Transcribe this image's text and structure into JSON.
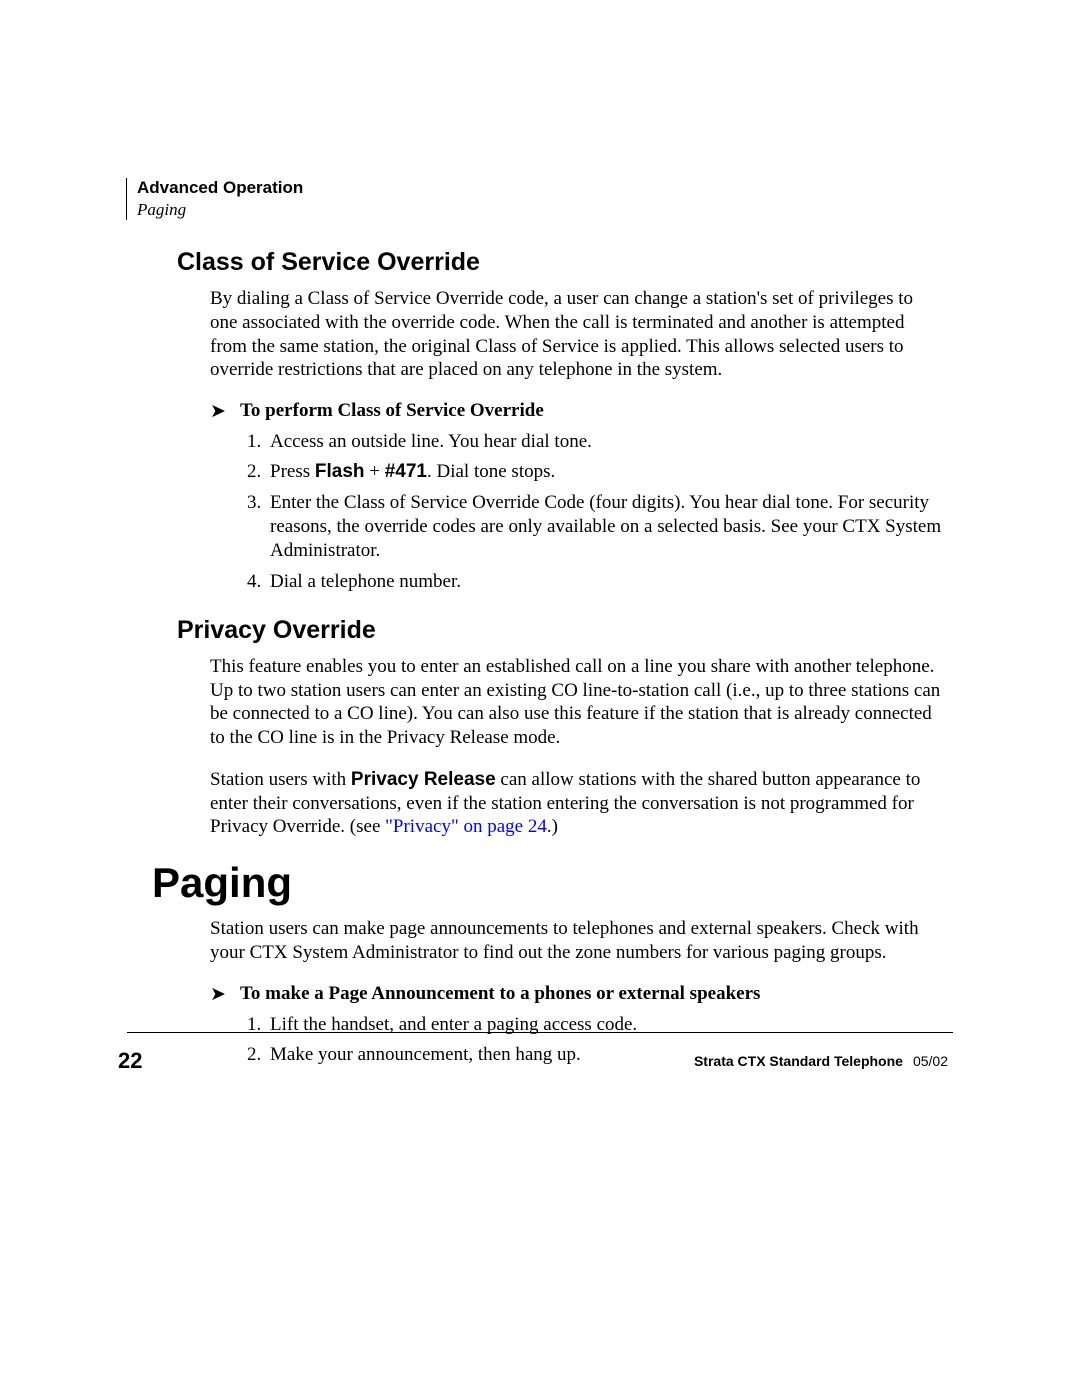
{
  "header": {
    "chapter": "Advanced Operation",
    "section": "Paging"
  },
  "sections": {
    "cos": {
      "heading": "Class of Service Override",
      "para": "By dialing a Class of Service Override code, a user can change a station's set of privileges to one associated with the override code. When the call is terminated and another is attempted from the same station, the original Class of Service is applied. This allows selected users to override restrictions that are placed on any telephone in the system.",
      "proc_heading": "To perform Class of Service Override",
      "steps": {
        "s1": "Access an outside line. You hear dial tone.",
        "s2_pre": "Press ",
        "s2_strong": "Flash",
        "s2_mid": " + ",
        "s2_code": "#471",
        "s2_post": ". Dial tone stops.",
        "s3": "Enter the Class of Service Override Code (four digits). You hear dial tone. For security reasons, the override codes are only available on a selected basis. See your CTX System Administrator.",
        "s4": "Dial a telephone number."
      }
    },
    "privacy": {
      "heading": "Privacy Override",
      "para1": "This feature enables you to enter an established call on a line you share with another telephone. Up to two station users can enter an existing CO line-to-station call (i.e., up to three stations can be connected to a CO line). You can also use this feature if the station that is already connected to the CO line is in the Privacy Release mode.",
      "para2_pre": "Station users with ",
      "para2_strong": "Privacy Release",
      "para2_mid": " can allow stations with the shared button appearance to enter their conversations, even if the station entering the conversation is not programmed for Privacy Override. (see ",
      "para2_link": "\"Privacy\" on page 24",
      "para2_post": ".)"
    },
    "paging": {
      "heading": "Paging",
      "para": "Station users can make page announcements to telephones and external speakers. Check with your CTX System Administrator to find out the zone numbers for various paging groups.",
      "proc_heading": "To make a Page Announcement to a phones or external speakers",
      "steps": {
        "s1": "Lift the handset, and enter a paging access code.",
        "s2": "Make your announcement, then hang up."
      }
    }
  },
  "footer": {
    "page_number": "22",
    "doc": "Strata CTX Standard Telephone",
    "date": "05/02"
  }
}
